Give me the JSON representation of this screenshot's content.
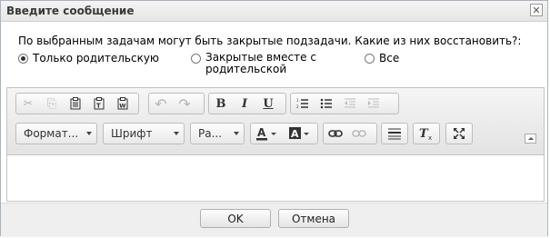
{
  "dialog": {
    "title": "Введите сообщение",
    "close_glyph": "✕",
    "question": "По выбранным задачам могут быть закрытые подзадачи. Какие из них восстановить?:",
    "options": [
      {
        "label": "Только родительскую",
        "selected": true
      },
      {
        "label_line1": "Закрытые вместе с",
        "label_line2": "родительской",
        "selected": false
      },
      {
        "label": "Все",
        "selected": false
      }
    ]
  },
  "toolbar": {
    "icons": {
      "cut": "✂",
      "copy": "⎘",
      "paste": "📋",
      "paste_text": "T",
      "paste_word": "W",
      "undo": "↶",
      "redo": "↷",
      "bold": "B",
      "italic": "I",
      "underline": "U",
      "numbered_list": "≡",
      "bulleted_list": "☰",
      "outdent": "⇤",
      "indent": "⇥",
      "text_color": "A",
      "bg_color": "A",
      "link": "🔗",
      "unlink": "⛓",
      "hr": "≡",
      "remove_format": "T",
      "maximize": "⤢"
    },
    "format_label": "Формат...",
    "font_label": "Шрифт",
    "size_label": "Ра..."
  },
  "footer": {
    "ok_label": "OK",
    "cancel_label": "Отмена"
  }
}
